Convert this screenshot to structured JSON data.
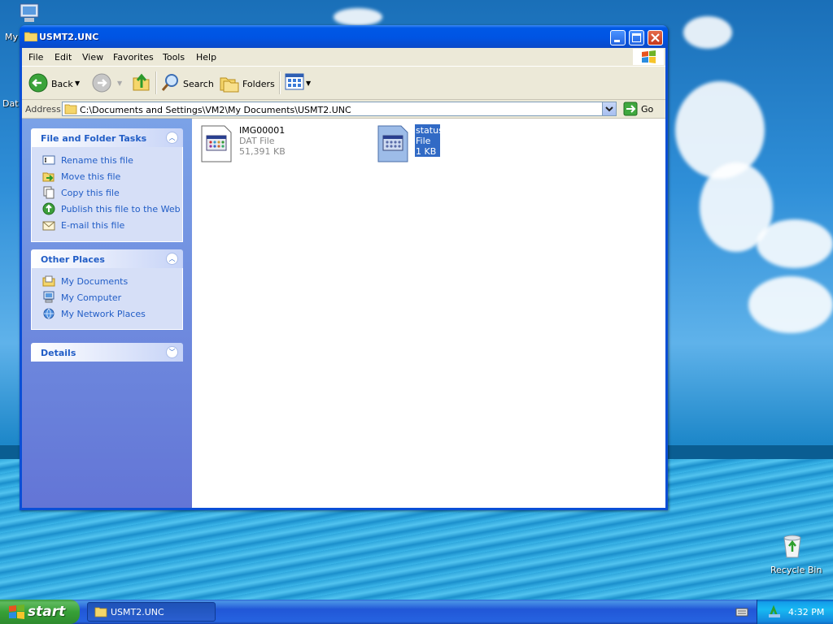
{
  "desktop": {
    "icons": [
      {
        "label": "My",
        "icon": "my-computer-icon"
      },
      {
        "label": "Dat",
        "icon": "data-icon"
      },
      {
        "label": "Recycle Bin",
        "icon": "recycle-bin-icon"
      }
    ]
  },
  "window": {
    "title": "USMT2.UNC",
    "menu": [
      "File",
      "Edit",
      "View",
      "Favorites",
      "Tools",
      "Help"
    ],
    "toolbar": {
      "back_label": "Back",
      "search_label": "Search",
      "folders_label": "Folders"
    },
    "address": {
      "label": "Address",
      "value": "C:\\Documents and Settings\\VM2\\My Documents\\USMT2.UNC",
      "go_label": "Go"
    },
    "tasks": {
      "file_folder_title": "File and Folder Tasks",
      "file_folder_items": [
        {
          "label": "Rename this file",
          "icon": "rename-icon"
        },
        {
          "label": "Move this file",
          "icon": "move-icon"
        },
        {
          "label": "Copy this file",
          "icon": "copy-icon"
        },
        {
          "label": "Publish this file to the Web",
          "icon": "publish-web-icon"
        },
        {
          "label": "E-mail this file",
          "icon": "email-icon"
        }
      ],
      "other_places_title": "Other Places",
      "other_places_items": [
        {
          "label": "My Documents",
          "icon": "my-documents-icon"
        },
        {
          "label": "My Computer",
          "icon": "my-computer-icon"
        },
        {
          "label": "My Network Places",
          "icon": "network-places-icon"
        }
      ],
      "details_title": "Details"
    },
    "files": [
      {
        "name": "IMG00001",
        "type": "DAT File",
        "size": "51,391 KB",
        "selected": false
      },
      {
        "name": "status",
        "type": "File",
        "size": "1 KB",
        "selected": true
      }
    ]
  },
  "taskbar": {
    "start_label": "start",
    "task_label": "USMT2.UNC",
    "clock": "4:32 PM"
  },
  "colors": {
    "title_blue": "#0054e3",
    "link_blue": "#215dc6",
    "selection": "#316ac5",
    "start_green": "#37a037"
  }
}
